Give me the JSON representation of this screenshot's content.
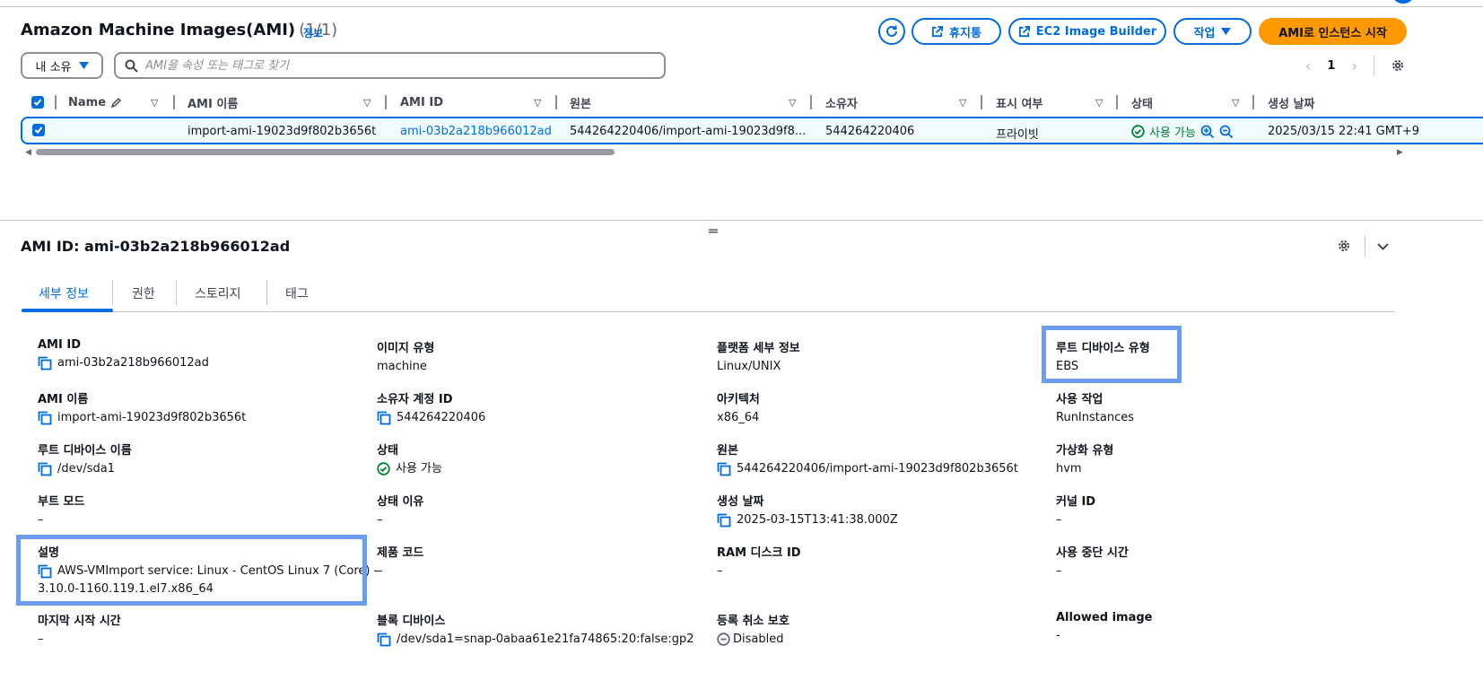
{
  "header": {
    "title": "Amazon Machine Images(AMI)",
    "count": "(1/1)",
    "info_link": "정보",
    "buttons": {
      "recycle_bin": "휴지통",
      "image_builder": "EC2 Image Builder",
      "actions": "작업",
      "launch": "AMI로 인스턴스 시작"
    }
  },
  "filter": {
    "owner_dropdown": "내 소유",
    "search_placeholder": "AMI을 속성 또는 태그로 찾기"
  },
  "pagination": {
    "prev": "‹",
    "page": "1",
    "next": "›"
  },
  "table": {
    "headers": [
      "Name",
      "AMI 이름",
      "AMI ID",
      "원본",
      "소유자",
      "표시 여부",
      "상태",
      "생성 날짜"
    ],
    "row": {
      "name": "",
      "ami_name": "import-ami-19023d9f802b3656t",
      "ami_id": "ami-03b2a218b966012ad",
      "source": "544264220406/import-ami-19023d9f8...",
      "owner": "544264220406",
      "visibility": "프라이빗",
      "status": "사용 가능",
      "created": "2025/03/15 22:41 GMT+9"
    }
  },
  "detail": {
    "title": "AMI ID: ami-03b2a218b966012ad",
    "tabs": [
      "세부 정보",
      "권한",
      "스토리지",
      "태그"
    ],
    "fields": {
      "ami_id": {
        "label": "AMI ID",
        "value": "ami-03b2a218b966012ad"
      },
      "image_type": {
        "label": "이미지 유형",
        "value": "machine"
      },
      "platform": {
        "label": "플랫폼 세부 정보",
        "value": "Linux/UNIX"
      },
      "root_device_type": {
        "label": "루트 디바이스 유형",
        "value": "EBS"
      },
      "ami_name": {
        "label": "AMI 이름",
        "value": "import-ami-19023d9f802b3656t"
      },
      "owner_account": {
        "label": "소유자 계정 ID",
        "value": "544264220406"
      },
      "architecture": {
        "label": "아키텍처",
        "value": "x86_64"
      },
      "usage_operation": {
        "label": "사용 작업",
        "value": "RunInstances"
      },
      "root_device_name": {
        "label": "루트 디바이스 이름",
        "value": "/dev/sda1"
      },
      "state": {
        "label": "상태",
        "value": "사용 가능"
      },
      "source": {
        "label": "원본",
        "value": "544264220406/import-ami-19023d9f802b3656t"
      },
      "virtualization": {
        "label": "가상화 유형",
        "value": "hvm"
      },
      "boot_mode": {
        "label": "부트 모드",
        "value": "–"
      },
      "state_reason": {
        "label": "상태 이유",
        "value": "–"
      },
      "creation_date": {
        "label": "생성 날짜",
        "value": "2025-03-15T13:41:38.000Z"
      },
      "kernel_id": {
        "label": "커널 ID",
        "value": "–"
      },
      "description": {
        "label": "설명",
        "value": "AWS-VMImport service: Linux - CentOS Linux 7 (Core) -",
        "value2": "3.10.0-1160.119.1.el7.x86_64"
      },
      "product_code": {
        "label": "제품 코드",
        "value": "–"
      },
      "ram_disk": {
        "label": "RAM 디스크 ID",
        "value": "–"
      },
      "deprecation": {
        "label": "사용 중단 시간",
        "value": "–"
      },
      "last_launch": {
        "label": "마지막 시작 시간",
        "value": "–"
      },
      "block_devices": {
        "label": "블록 디바이스",
        "value": "/dev/sda1=snap-0abaa61e21fa74865:20:false:gp2"
      },
      "deregistration_protection": {
        "label": "등록 취소 보호",
        "value": "Disabled"
      },
      "allowed_image": {
        "label": "Allowed image",
        "value": "-"
      }
    }
  },
  "colors": {
    "accent": "#006ce0",
    "primary_button": "#ff9900",
    "success": "#00802f",
    "highlight": "#6e9cf0"
  }
}
